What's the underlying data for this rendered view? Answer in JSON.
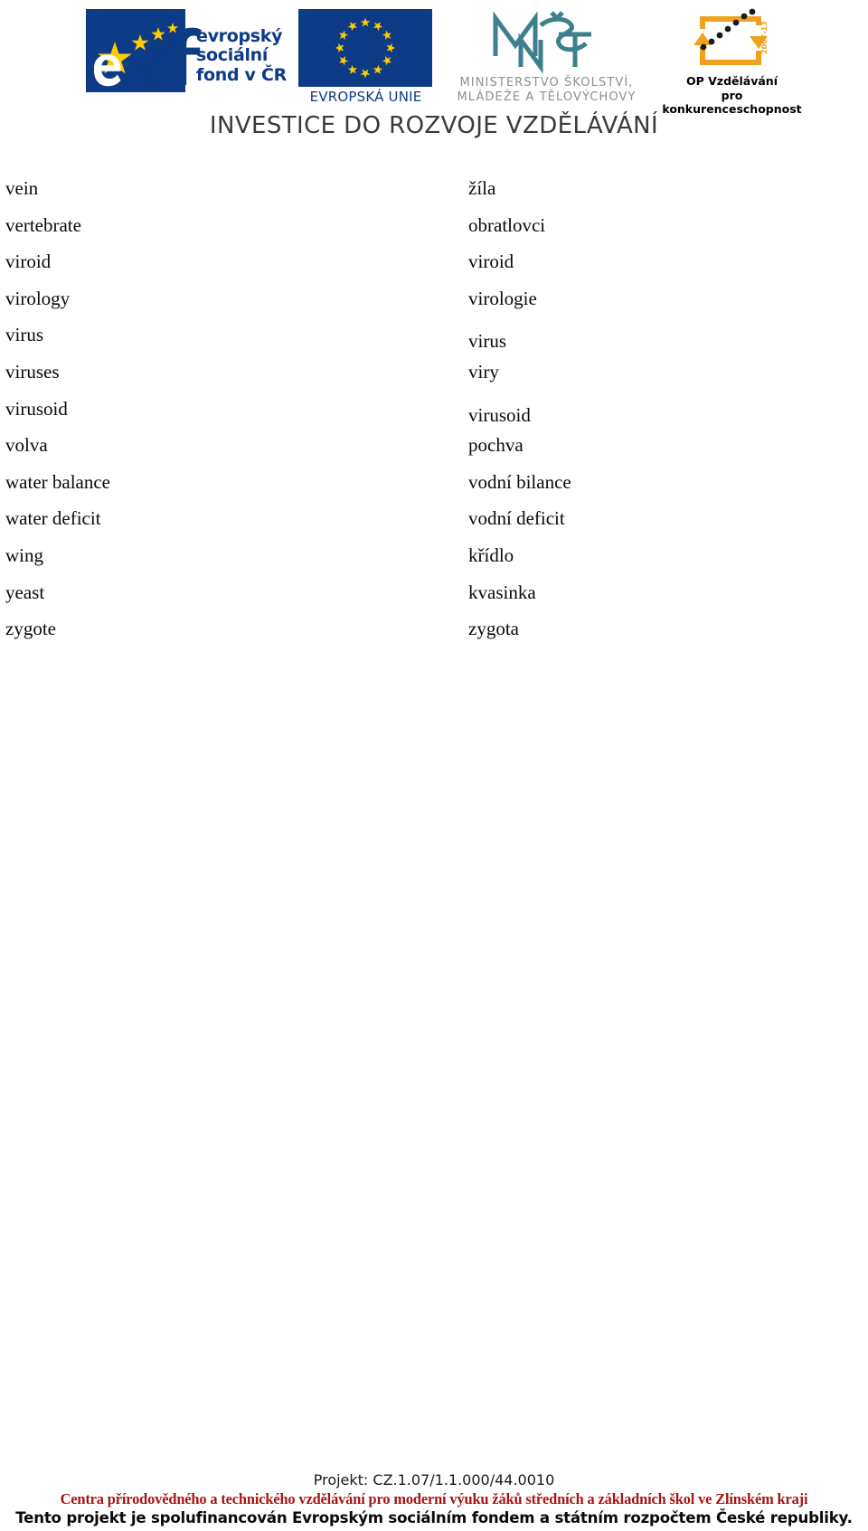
{
  "header": {
    "esf": {
      "name": "esf-logo",
      "line1": "evropský",
      "line2": "sociální",
      "line3": "fond v ČR",
      "letters": "esf",
      "brand_color": "#0d3b85",
      "star_color": "#ffcc00"
    },
    "eu": {
      "name": "european-union-flag",
      "caption": "EVROPSKÁ UNIE",
      "flag_color": "#0d3b85",
      "star_color": "#ffcc00"
    },
    "msmt": {
      "name": "msmt-logo",
      "mark": "MŠMT",
      "caption_line1": "MINISTERSTVO ŠKOLSTVÍ,",
      "caption_line2": "MLÁDEŽE A TĚLOVÝCHOVY",
      "mark_color": "#3d7f8c",
      "caption_color": "#8a8f96"
    },
    "opvk": {
      "name": "op-vzdelavani-logo",
      "caption_line1": "OP Vzdělávání",
      "caption_line2": "pro konkurenceschopnost",
      "period": "2007-13",
      "mark_color": "#f0a11e"
    },
    "banner": "INVESTICE DO ROZVOJE VZDĚLÁVÁNÍ"
  },
  "glossary": {
    "rows": [
      {
        "term": "vein",
        "definition": "žíla",
        "offset": "none"
      },
      {
        "term": "vertebrate",
        "definition": "obratlovci",
        "offset": "none"
      },
      {
        "term": "viroid",
        "definition": "viroid",
        "offset": "none"
      },
      {
        "term": "virology",
        "definition": "virologie",
        "offset": "none"
      },
      {
        "term": "virus",
        "definition": "virus",
        "offset": "down"
      },
      {
        "term": "viruses",
        "definition": "viry",
        "offset": "none"
      },
      {
        "term": "virusoid",
        "definition": "virusoid",
        "offset": "down"
      },
      {
        "term": "volva",
        "definition": "pochva",
        "offset": "none"
      },
      {
        "term": "water balance",
        "definition": "vodní bilance",
        "offset": "none"
      },
      {
        "term": "water deficit",
        "definition": "vodní deficit",
        "offset": "none"
      },
      {
        "term": "wing",
        "definition": "křídlo",
        "offset": "none"
      },
      {
        "term": "yeast",
        "definition": "kvasinka",
        "offset": "none"
      },
      {
        "term": "zygote",
        "definition": "zygota",
        "offset": "none"
      }
    ]
  },
  "footer": {
    "project": "Projekt: CZ.1.07/1.1.000/44.0010",
    "centra": "Centra přírodovědného a technického vzdělávání pro moderní výuku žáků středních a základních škol ve Zlínském kraji",
    "spolufinancovani": "Tento projekt je spolufinancován Evropským sociálním fondem a státním rozpočtem České republiky.",
    "centra_color": "#a81414"
  }
}
